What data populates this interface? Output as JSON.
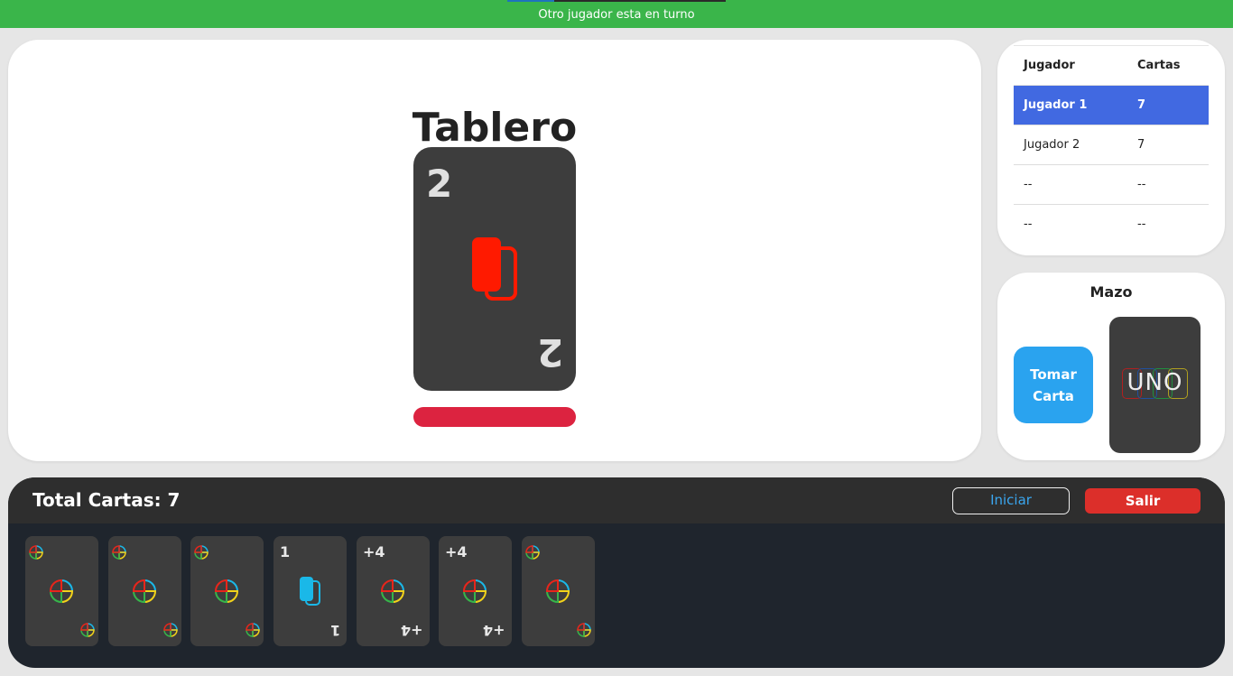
{
  "status_bar": {
    "message": "Otro jugador esta en turno"
  },
  "board": {
    "title": "Tablero",
    "top_card": {
      "value": "2",
      "color": "#ff1a00"
    },
    "current_color": "#dc2340"
  },
  "players_table": {
    "headers": [
      "Jugador",
      "Cartas"
    ],
    "rows": [
      {
        "name": "Jugador 1",
        "cards": "7",
        "active": true
      },
      {
        "name": "Jugador 2",
        "cards": "7",
        "active": false
      },
      {
        "name": "--",
        "cards": "--",
        "active": false
      },
      {
        "name": "--",
        "cards": "--",
        "active": false
      }
    ]
  },
  "deck": {
    "title": "Mazo",
    "take_button_line1": "Tomar",
    "take_button_line2": "Carta",
    "card_label": "UNO"
  },
  "hand": {
    "total_label": "Total Cartas: 7",
    "start_button": "Iniciar",
    "exit_button": "Salir",
    "cards": [
      {
        "type": "wild",
        "label": ""
      },
      {
        "type": "wild",
        "label": ""
      },
      {
        "type": "wild",
        "label": ""
      },
      {
        "type": "number",
        "label": "1",
        "color": "#1ab8e8"
      },
      {
        "type": "draw4",
        "label": "+4"
      },
      {
        "type": "draw4",
        "label": "+4"
      },
      {
        "type": "wild",
        "label": ""
      }
    ]
  },
  "colors": {
    "status_green": "#3ab54a",
    "active_row": "#4169e1",
    "take_button": "#2aa3ef",
    "exit_button": "#dc2f2a"
  }
}
